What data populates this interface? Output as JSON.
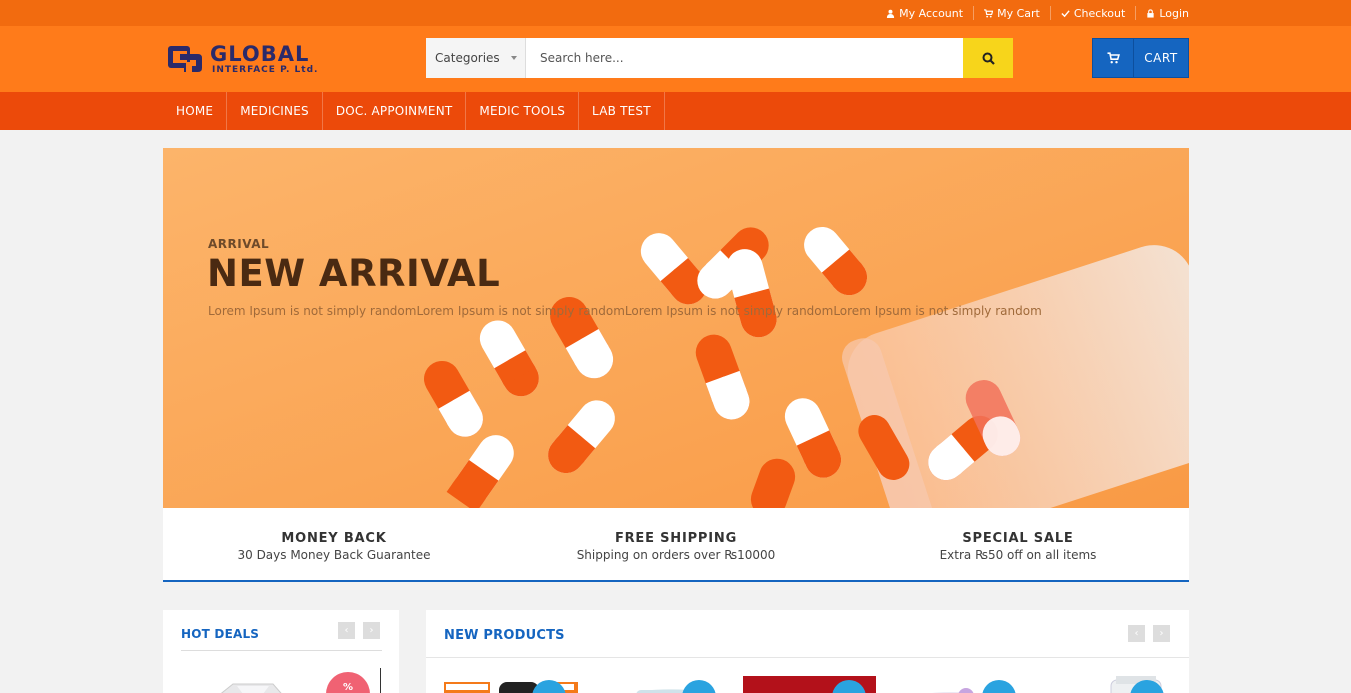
{
  "topbar": {
    "links": [
      {
        "label": "My Account",
        "icon": "user-icon"
      },
      {
        "label": "My Cart",
        "icon": "cart-icon"
      },
      {
        "label": "Checkout",
        "icon": "check-icon"
      },
      {
        "label": "Login",
        "icon": "lock-icon"
      }
    ]
  },
  "header": {
    "logo": {
      "word": "GLOBAL",
      "sub": "INTERFACE P. Ltd."
    },
    "search": {
      "category": "Categories",
      "placeholder": "Search here..."
    },
    "cart_label": "CART"
  },
  "nav": {
    "items": [
      "HOME",
      "MEDICINES",
      "DOC. APPOINMENT",
      "MEDIC TOOLS",
      "LAB TEST"
    ]
  },
  "hero": {
    "subtitle": "ARRIVAL",
    "title": "NEW ARRIVAL",
    "description": "Lorem Ipsum is not simply randomLorem Ipsum is not simply randomLorem Ipsum is not simply randomLorem Ipsum is not simply random"
  },
  "features": [
    {
      "title": "MONEY BACK",
      "text": "30 Days Money Back Guarantee"
    },
    {
      "title": "FREE SHIPPING",
      "text": "Shipping on orders over ₨10000"
    },
    {
      "title": "SPECIAL SALE",
      "text": "Extra ₨50 off on all items"
    }
  ],
  "hot_deals": {
    "title": "HOT DEALS",
    "badge": "%",
    "prev": "‹",
    "next": "›"
  },
  "new_products": {
    "title": "NEW PRODUCTS",
    "prev": "‹",
    "next": "›"
  },
  "colors": {
    "topbar": "#f26b0f",
    "header": "#ff7b1a",
    "nav": "#ec4a0a",
    "accent_blue": "#1565c0",
    "search_button": "#f7d51b"
  }
}
